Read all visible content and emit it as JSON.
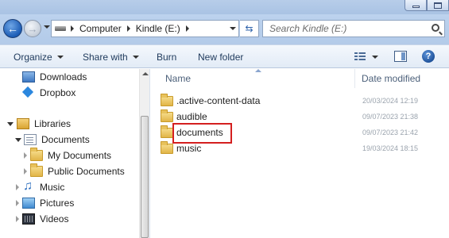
{
  "address": {
    "breadcrumbs": [
      "Computer",
      "Kindle (E:)"
    ],
    "search_placeholder": "Search Kindle (E:)"
  },
  "toolbar": {
    "organize_label": "Organize",
    "share_label": "Share with",
    "burn_label": "Burn",
    "new_folder_label": "New folder"
  },
  "nav": {
    "items": [
      {
        "label": "Downloads",
        "icon": "downloads-icon"
      },
      {
        "label": "Dropbox",
        "icon": "dropbox-icon"
      },
      {
        "label": "Libraries",
        "icon": "libraries-icon"
      },
      {
        "label": "Documents",
        "icon": "documents-icon"
      },
      {
        "label": "My Documents",
        "icon": "folder-icon"
      },
      {
        "label": "Public Documents",
        "icon": "folder-icon"
      },
      {
        "label": "Music",
        "icon": "music-icon"
      },
      {
        "label": "Pictures",
        "icon": "pictures-icon"
      },
      {
        "label": "Videos",
        "icon": "videos-icon"
      }
    ]
  },
  "content": {
    "columns": {
      "name": "Name",
      "date_modified": "Date modified"
    },
    "files": [
      {
        "name": ".active-content-data",
        "date": "20/03/2024 12:19"
      },
      {
        "name": "audible",
        "date": "09/07/2023 21:38"
      },
      {
        "name": "documents",
        "date": "09/07/2023 21:42",
        "highlighted": true
      },
      {
        "name": "music",
        "date": "19/03/2024 18:15"
      }
    ]
  },
  "colors": {
    "highlight_box": "#d41f1f",
    "toolbar_text": "#1e395b"
  }
}
